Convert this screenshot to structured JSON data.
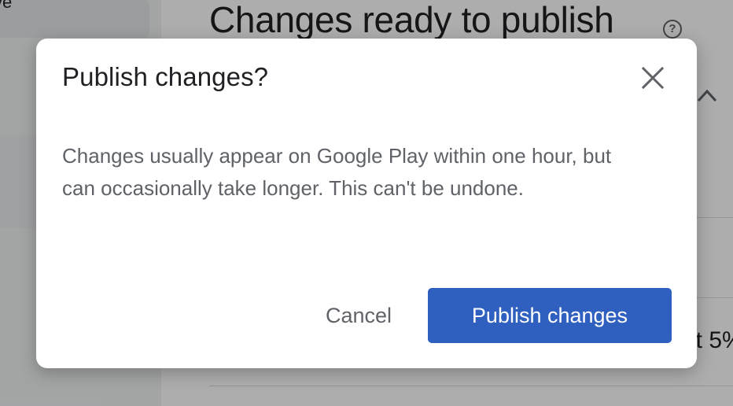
{
  "background": {
    "sidebar_fragment": "ve",
    "page_title": "Changes ready to publish",
    "partial_text": "at 5%"
  },
  "dialog": {
    "title": "Publish changes?",
    "body": "Changes usually appear on Google Play within one hour, but can occasionally take longer. This can't be undone.",
    "cancel_label": "Cancel",
    "publish_label": "Publish changes",
    "close_icon": "close-icon"
  },
  "colors": {
    "primary": "#2f5fbf",
    "title_text": "#202124",
    "body_text": "#5f6368",
    "scrim": "rgba(0,0,0,0.32)"
  }
}
